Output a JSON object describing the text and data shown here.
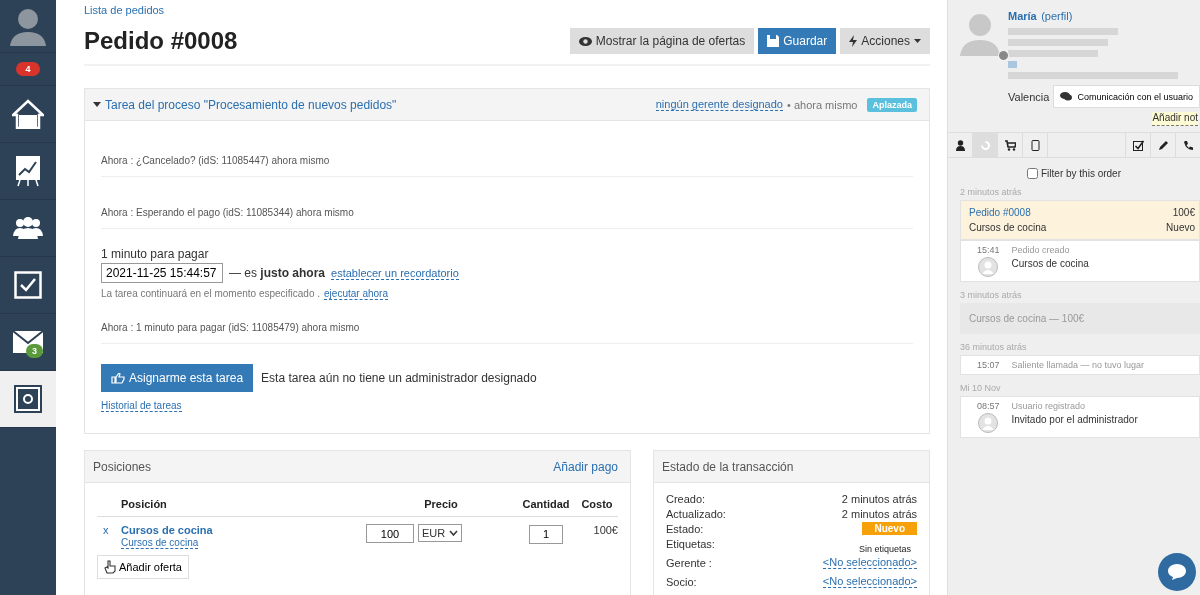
{
  "sidebar": {
    "notifications_badge": "4",
    "items": [
      {
        "kind": "home",
        "selected": false
      },
      {
        "kind": "chart",
        "selected": false
      },
      {
        "kind": "team",
        "selected": false
      },
      {
        "kind": "tasks",
        "selected": false
      },
      {
        "kind": "mail",
        "selected": false,
        "badge": "3"
      },
      {
        "kind": "safe",
        "selected": true
      }
    ]
  },
  "breadcrumb": "Lista de pedidos",
  "title": "Pedido #0008",
  "header_buttons": [
    {
      "kind": "eye",
      "label": "Mostrar la página de ofertas",
      "primary": false
    },
    {
      "kind": "save",
      "label": "Guardar",
      "primary": true
    },
    {
      "kind": "actions",
      "label": "Acciones",
      "primary": false
    }
  ],
  "task_panel": {
    "expanded": true,
    "title": "Tarea del proceso \"Procesamiento de nuevos pedidos\"",
    "manager_link": "ningún gerente designado",
    "meta": "• ahora mismo",
    "status_badge": "Aplazada",
    "log": [
      "Ahora : ¿Cancelado? (idS: 11085447) ahora mismo",
      "Ahora : Esperando el pago (idS: 11085344) ahora mismo"
    ],
    "wait": {
      "label": "1 minuto para pagar",
      "datetime": "2021-11-25 15:44:57",
      "suffix": "— es **justo ahora**",
      "reminder_link": "establecer un recordatorio",
      "note": "La tarea continuará en el momento especificado .",
      "run_link": "ejecutar ahora"
    },
    "last_log": "Ahora : 1 minuto para pagar (idS: 11085479) ahora mismo",
    "assign_button": "Asignarme esta tarea",
    "assign_note": "Esta tarea aún no tiene un administrador designado",
    "history_link": "Historial de tareas"
  },
  "positions": {
    "title": "Posiciones",
    "add_payment": "Añadir pago",
    "columns": [
      "Posición",
      "Precio",
      "Cantidad",
      "Costo"
    ],
    "rows": [
      {
        "remove": "x",
        "name": "Cursos de cocina",
        "subname": "Cursos de cocina",
        "price": "100",
        "currency": "EUR",
        "quantity": "1",
        "cost": "100€"
      }
    ],
    "add_offer": "Añadir oferta"
  },
  "transaction": {
    "title": "Estado de la transacción",
    "fields": [
      {
        "kind": "text",
        "label": "Creado:",
        "value": "2 minutos atrás"
      },
      {
        "kind": "text",
        "label": "Actualizado:",
        "value": "2 minutos atrás"
      },
      {
        "kind": "badge",
        "label": "Estado:",
        "value": "Nuevo"
      },
      {
        "kind": "small",
        "label": "Etiquetas:",
        "value": "Sin etiquetas"
      },
      {
        "kind": "link",
        "label": "Gerente :",
        "value": "<No seleccionado>"
      },
      {
        "kind": "link",
        "label": "Socio:",
        "value": "<No seleccionado>"
      }
    ]
  },
  "profile": {
    "name": "María",
    "profile_link": "(perfil)",
    "city": "Valencia",
    "contact_button": "Comunicación con el usuario",
    "add_note": "Añadir not"
  },
  "profile_tabs": {
    "left": [
      {
        "kind": "user",
        "selected": false
      },
      {
        "kind": "history",
        "selected": true
      },
      {
        "kind": "cart",
        "selected": false
      },
      {
        "kind": "tablet",
        "selected": false
      }
    ],
    "right": [
      {
        "kind": "check",
        "selected": false
      },
      {
        "kind": "pencil",
        "selected": false
      },
      {
        "kind": "phone",
        "selected": false
      }
    ]
  },
  "filter": {
    "label": "Filter by this order",
    "checked": false
  },
  "timeline": [
    {
      "date": "2 minutos atrás",
      "entries": [
        {
          "kind": "order",
          "title": "Pedido #0008",
          "amount": "100€",
          "subtitle": "Cursos de cocina",
          "status": "Nuevo"
        },
        {
          "kind": "event",
          "time": "15:41",
          "title": "Pedido creado",
          "text": "Cursos de cocina",
          "avatar": true
        }
      ]
    },
    {
      "date": "3 minutos atrás",
      "entries": [
        {
          "kind": "muted",
          "text": "Cursos de cocina — 100€"
        }
      ]
    },
    {
      "date": "36 minutos atrás",
      "entries": [
        {
          "kind": "event",
          "time": "15:07",
          "title": "Saliente llamada — no tuvo lugar",
          "avatar": false
        }
      ]
    },
    {
      "date": "Mi 10 Nov",
      "entries": [
        {
          "kind": "event",
          "time": "08:57",
          "title": "Usuario registrado",
          "text": "Invitado por el administrador",
          "avatar": true
        }
      ]
    }
  ]
}
